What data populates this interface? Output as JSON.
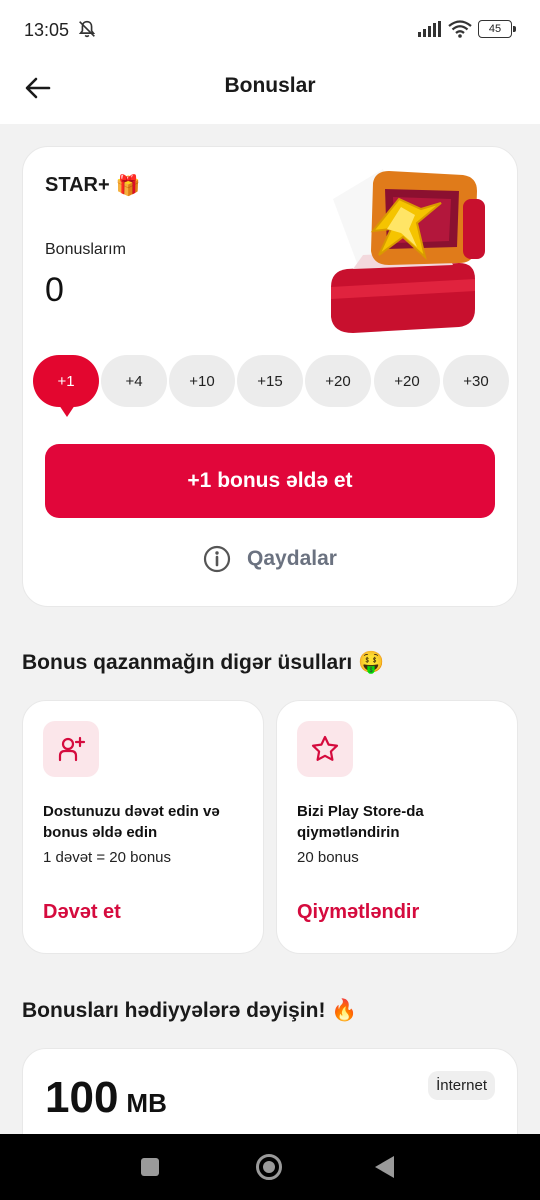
{
  "status_bar": {
    "time": "13:05",
    "battery": "45",
    "icons": [
      "mute-icon",
      "signal-icon",
      "wifi-icon",
      "battery-icon"
    ]
  },
  "header": {
    "title": "Bonuslar",
    "back_icon": "arrow-left-icon"
  },
  "star_card": {
    "title": "STAR+",
    "title_emoji": "🎁",
    "bonus_label": "Bonuslarım",
    "bonus_value": "0",
    "chips": [
      "+1",
      "+4",
      "+10",
      "+15",
      "+20",
      "+20",
      "+30"
    ],
    "selected_chip": "+1",
    "cta_label": "+1 bonus əldə et",
    "rules_label": "Qaydalar"
  },
  "other_ways": {
    "title": "Bonus qazanmağın digər üsulları",
    "title_emoji": "🤑",
    "cards": [
      {
        "icon": "add-user-icon",
        "title": "Dostunuzu dəvət edin və bonus əldə edin",
        "subtitle": "1 dəvət = 20 bonus",
        "action": "Dəvət et"
      },
      {
        "icon": "star-icon",
        "title": "Bizi Play Store-da qiymətləndirin",
        "subtitle": "20 bonus",
        "action": "Qiymətləndir"
      }
    ]
  },
  "gifts": {
    "title": "Bonusları hədiyyələrə dəyişin!",
    "title_emoji": "🔥",
    "first_gift": {
      "amount": "100",
      "unit": "MB",
      "tag": "İnternet"
    }
  },
  "colors": {
    "brand_red": "#e1063a",
    "link_red": "#d50b3e",
    "icon_bg": "#fbe6ea",
    "page_bg": "#f2f2f2"
  }
}
